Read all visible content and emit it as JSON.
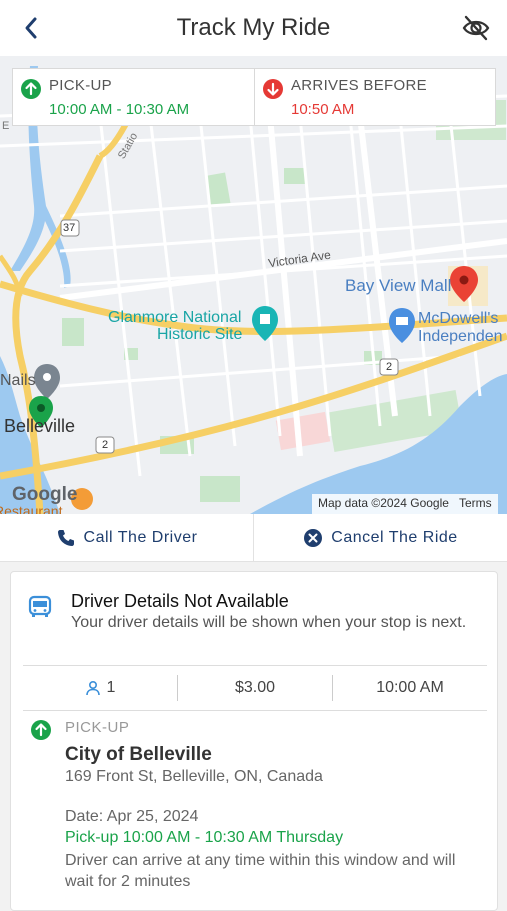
{
  "header": {
    "title": "Track My Ride",
    "back_icon": "chevron-left-icon",
    "hide_icon": "eye-off-icon"
  },
  "times": {
    "pickup_label": "PICK-UP",
    "pickup_window": "10:00 AM - 10:30 AM",
    "arrive_label": "ARRIVES BEFORE",
    "arrive_time": "10:50 AM",
    "pickup_color": "#1aa34a",
    "arrive_color": "#e53935"
  },
  "map": {
    "labels": {
      "victoria_ave": "Victoria Ave",
      "bay_view_mall": "Bay View Mall",
      "glanmore_1": "Glanmore National",
      "glanmore_2": "Historic Site",
      "mcdowells_1": "McDowell's",
      "mcdowells_2": "Independen",
      "nails": "Nails",
      "belleville": "Belleville",
      "route_37": "37",
      "route_2a": "2",
      "route_2b": "2",
      "station": "Statio",
      "google": "Google",
      "map_data": "Map data ©2024 Google",
      "terms": "Terms",
      "cut_left": "E",
      "cut_bottom": "Restaurant"
    }
  },
  "actions": {
    "call_label": "Call The Driver",
    "cancel_label": "Cancel The Ride"
  },
  "driver": {
    "title": "Driver Details Not Available",
    "subtitle": "Your driver details will be shown when your stop is next."
  },
  "stats": {
    "passengers": "1",
    "fare": "$3.00",
    "time": "10:00 AM"
  },
  "pickup": {
    "label": "PICK-UP",
    "name": "City of Belleville",
    "address": "169 Front St, Belleville, ON, Canada",
    "date": "Date: Apr 25, 2024",
    "window": "Pick-up 10:00 AM - 10:30 AM Thursday",
    "note": "Driver can arrive at any time within this window and will wait for 2 minutes"
  },
  "colors": {
    "accent_navy": "#1f3e6e",
    "green": "#1aa34a",
    "red": "#e53935",
    "water": "#9dc9f0",
    "road_major": "#f6cf65"
  }
}
